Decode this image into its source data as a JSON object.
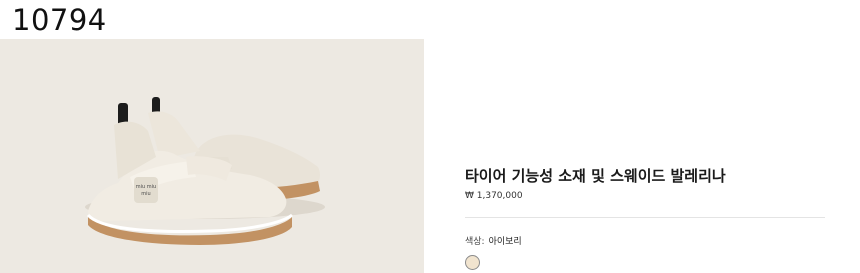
{
  "page": {
    "id_label": "10794"
  },
  "product": {
    "title": "타이어 기능성 소재 및 스웨이드 발레리나",
    "price": "₩ 1,370,000",
    "color_label": "색상:",
    "color_value": "아이보리",
    "swatch_color": "#f1e4cf",
    "image_logo_text": "miu miu"
  },
  "colors": {
    "image_background": "#ede9e2",
    "sole": "#c29263",
    "upper": "#f1ece3"
  }
}
